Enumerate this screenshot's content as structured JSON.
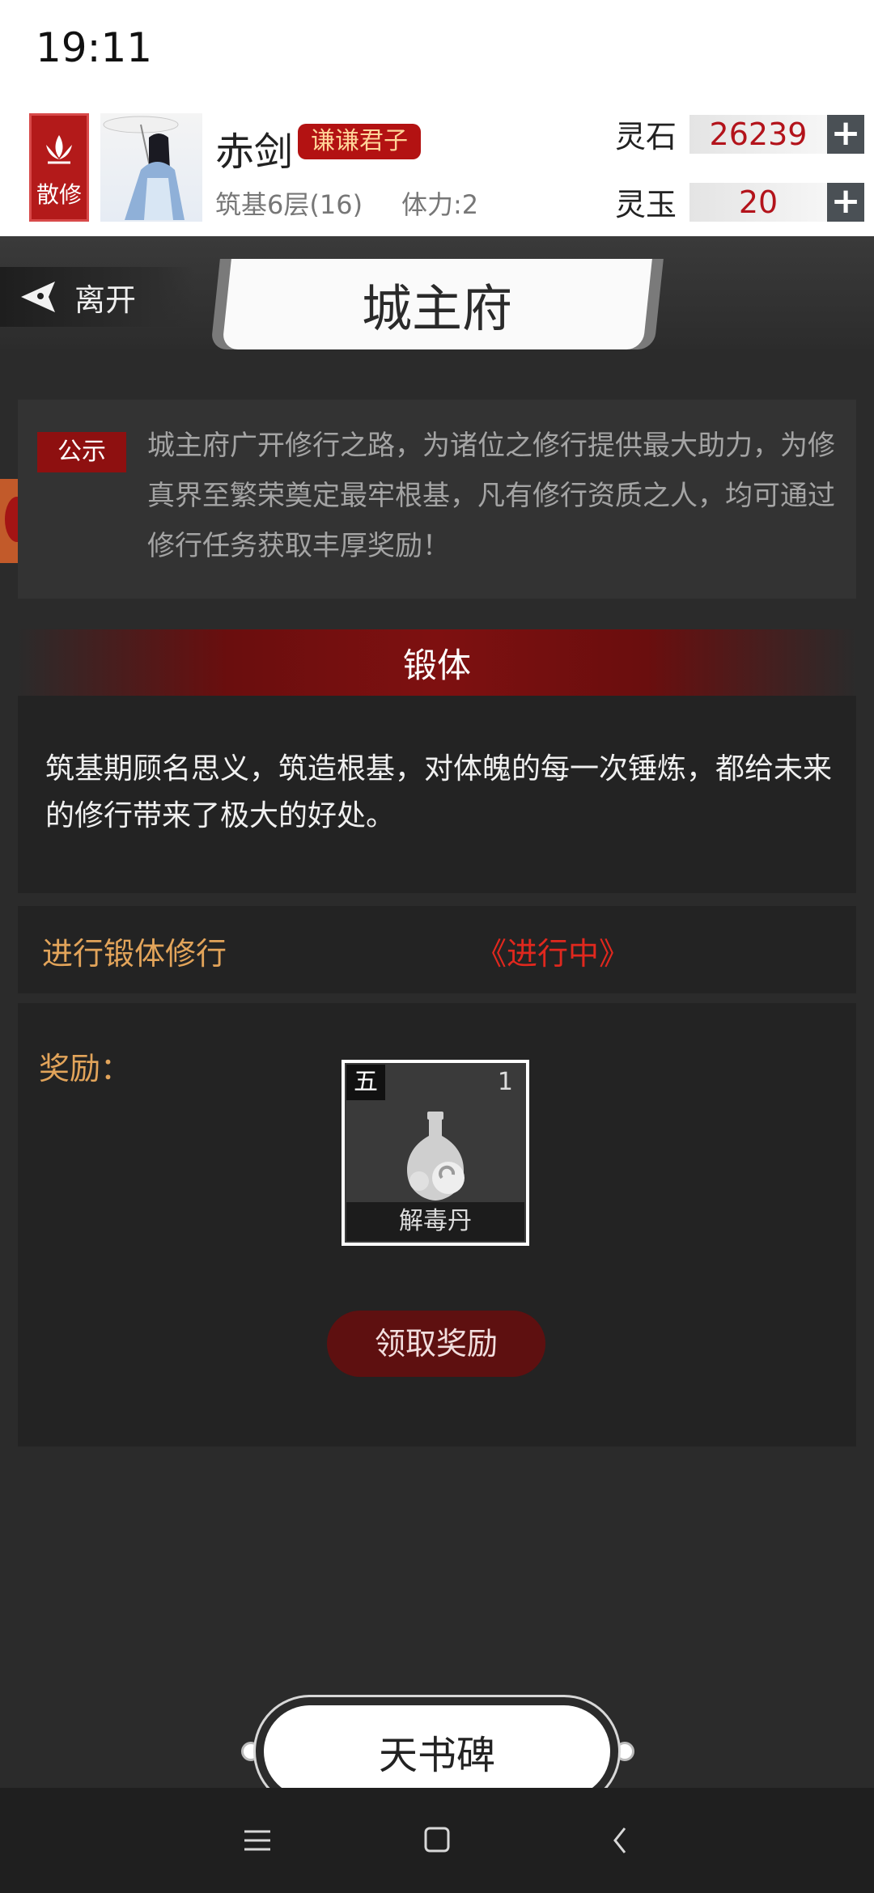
{
  "status_bar": {
    "time": "19:11"
  },
  "player": {
    "sect_label": "散修",
    "name": "赤剑",
    "title": "谦谦君子",
    "realm": "筑基6层(16)",
    "stamina": "体力:2"
  },
  "resources": [
    {
      "label": "灵石",
      "value": "26239"
    },
    {
      "label": "灵玉",
      "value": "20"
    }
  ],
  "nav": {
    "leave_label": "离开",
    "page_title": "城主府"
  },
  "notice": {
    "tag": "公示",
    "text": "城主府广开修行之路，为诸位之修行提供最大助力，为修真界至繁荣奠定最牢根基，凡有修行资质之人，均可通过修行任务获取丰厚奖励！"
  },
  "quest": {
    "title": "锻体",
    "description": "筑基期顾名思义，筑造根基，对体魄的每一次锤炼，都给未来的修行带来了极大的好处。",
    "task": "进行锻体修行",
    "status": "《进行中》",
    "reward_label": "奖励：",
    "reward_item": {
      "grade": "五",
      "quantity": "1",
      "name": "解毒丹"
    },
    "claim_label": "领取奖励"
  },
  "bottom": {
    "tianshu_label": "天书碑"
  },
  "colors": {
    "accent_red": "#b31a1a",
    "gold_text": "#e2a45a",
    "status_red": "#e0281e"
  },
  "icons": [
    "lotus-icon",
    "leave-arrow-icon",
    "plus-icon",
    "pill-bottle-icon",
    "menu-icon",
    "home-icon",
    "back-icon"
  ]
}
